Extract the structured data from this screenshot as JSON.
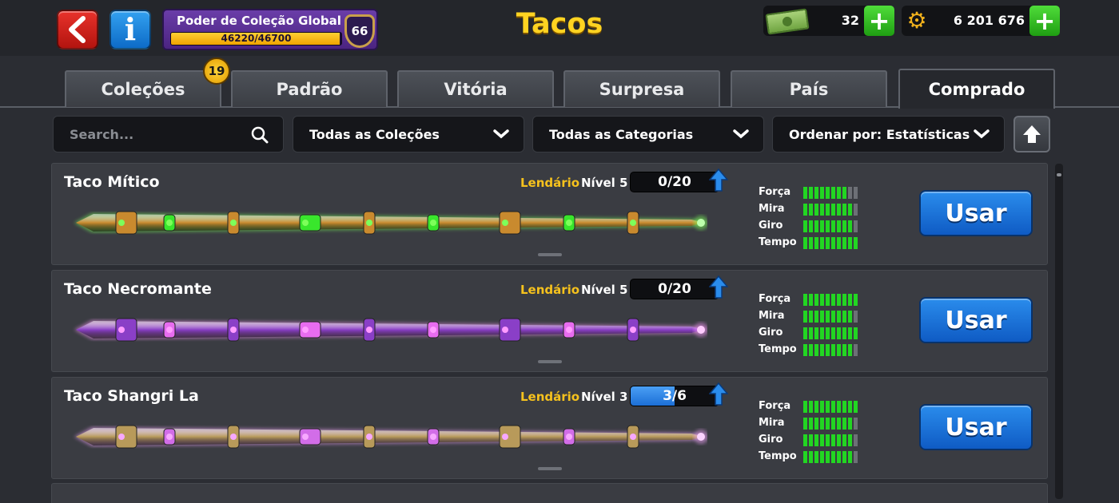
{
  "header": {
    "title": "Tacos",
    "power": {
      "title": "Poder de Coleção Global",
      "progress_text": "46220/46700",
      "progress": 0.9897,
      "level": "66"
    },
    "cash": {
      "value": "32"
    },
    "coins": {
      "value": "6 201 676"
    },
    "plus_label": "+"
  },
  "tabs": [
    {
      "label": "Coleções",
      "badge": "19"
    },
    {
      "label": "Padrão"
    },
    {
      "label": "Vitória"
    },
    {
      "label": "Surpresa"
    },
    {
      "label": "País"
    },
    {
      "label": "Comprado",
      "active": true
    }
  ],
  "filters": {
    "search_placeholder": "Search...",
    "collections": "Todas as Coleções",
    "categories": "Todas as Categorias",
    "sort": "Ordenar por: Estatísticas"
  },
  "stat_labels": [
    "Força",
    "Mira",
    "Giro",
    "Tempo"
  ],
  "use_label": "Usar",
  "cues": [
    {
      "name": "Taco Mítico",
      "rarity": "Lendário",
      "level": "Nível 5",
      "progress_text": "0/20",
      "progress": 0,
      "stats": [
        8,
        9,
        9,
        10
      ],
      "stat_max": 10,
      "colors": {
        "primary": "#c98a2e",
        "accent": "#39e62c",
        "glow": "#7dff5a"
      }
    },
    {
      "name": "Taco Necromante",
      "rarity": "Lendário",
      "level": "Nível 5",
      "progress_text": "0/20",
      "progress": 0,
      "stats": [
        10,
        9,
        10,
        9
      ],
      "stat_max": 10,
      "colors": {
        "primary": "#8a3fc7",
        "accent": "#e86cf0",
        "glow": "#ff9bff"
      }
    },
    {
      "name": "Taco Shangri La",
      "rarity": "Lendário",
      "level": "Nível 3",
      "progress_text": "3/6",
      "progress": 0.5,
      "stats": [
        10,
        9,
        9,
        9
      ],
      "stat_max": 10,
      "colors": {
        "primary": "#b89a5a",
        "accent": "#d26de8",
        "glow": "#f7a8ff"
      }
    }
  ]
}
